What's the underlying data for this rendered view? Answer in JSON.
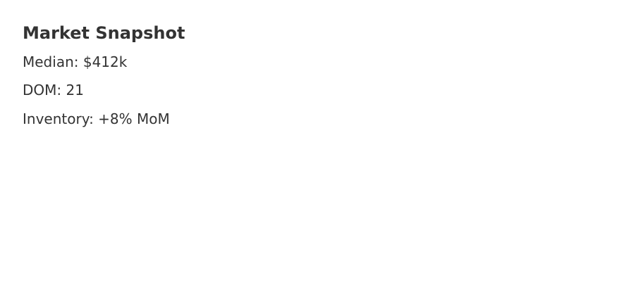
{
  "snapshot": {
    "title": "Market Snapshot",
    "median": "Median: $412k",
    "dom": "DOM: 21",
    "inventory": "Inventory: +8% MoM"
  },
  "colors": {
    "background": "#ffffff",
    "text": "#333333"
  }
}
